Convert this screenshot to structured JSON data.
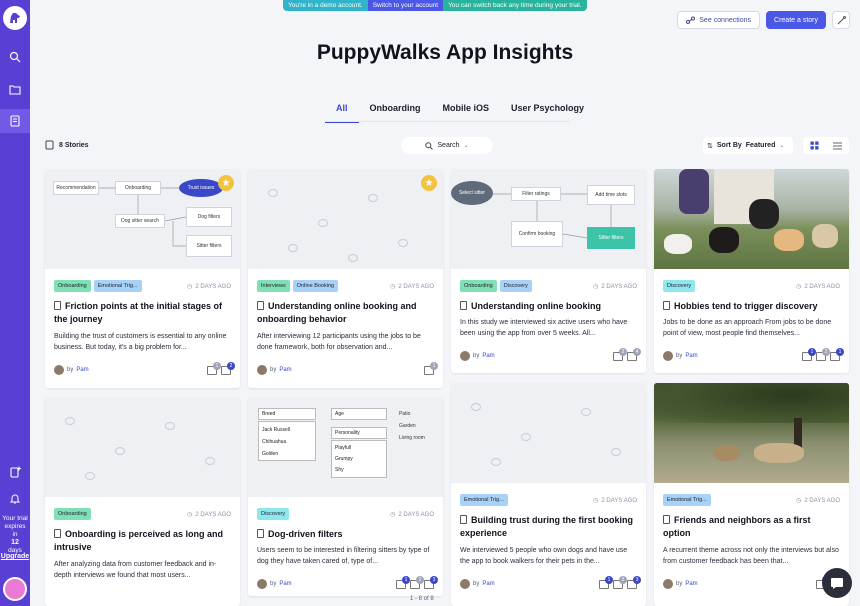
{
  "banner": {
    "demo": "You're in a demo account.",
    "switch": "Switch to your account",
    "info": "You can switch back any time during your trial.",
    "colors": {
      "demo": "#2fb4c9",
      "switch": "#4b57e5",
      "info": "#28b49c"
    }
  },
  "header": {
    "see_connections": "See connections",
    "create_story": "Create a story",
    "title": "PuppyWalks App Insights"
  },
  "tabs": [
    {
      "label": "All",
      "active": true
    },
    {
      "label": "Onboarding",
      "active": false
    },
    {
      "label": "Mobile iOS",
      "active": false
    },
    {
      "label": "User Psychology",
      "active": false
    }
  ],
  "toolbar": {
    "stories_count": "8 Stories",
    "search_label": "Search",
    "sort_label": "Sort By",
    "sort_value": "Featured"
  },
  "sidebar": {
    "trial_line1": "Your trial",
    "trial_line2": "expires",
    "trial_line3": "in",
    "trial_days": "12",
    "trial_line4": "days",
    "upgrade": "Upgrade"
  },
  "cards": [
    {
      "tags": [
        {
          "label": "Onboarding",
          "color": "green"
        },
        {
          "label": "Emotional Trig...",
          "color": "blue"
        }
      ],
      "date": "2 DAYS AGO",
      "title": "Friction points at the initial stages of the journey",
      "desc": "Building the trust of customers is essential to any online business. But today, it's a big problem for...",
      "author_prefix": "by",
      "author": "Pam",
      "badges": [
        "1",
        "2"
      ],
      "starred": true,
      "diagram": [
        "Recommendation",
        "Onboarding",
        "Trust issues",
        "Dog sitter search",
        "Dog filters",
        "Sitter filters"
      ]
    },
    {
      "tags": [
        {
          "label": "Interviews",
          "color": "green"
        },
        {
          "label": "Online Booking",
          "color": "blue"
        }
      ],
      "date": "2 DAYS AGO",
      "title": "Understanding online booking and onboarding behavior",
      "desc": "After interviewing 12 participants using the jobs to be done framework, both for observation and...",
      "author_prefix": "by",
      "author": "Pam",
      "badges": [
        "1"
      ],
      "starred": true
    },
    {
      "tags": [
        {
          "label": "Onboarding",
          "color": "green"
        },
        {
          "label": "Discovery",
          "color": "blue"
        }
      ],
      "date": "2 DAYS AGO",
      "title": "Understanding online booking",
      "desc": "In this study we interviewed six active users who have been using the app from over 5 weeks. All...",
      "author_prefix": "by",
      "author": "Pam",
      "badges": [
        "2",
        "4"
      ],
      "diagram": [
        "Select sitter",
        "Filter ratings",
        "Add time slots",
        "Confirm booking",
        "Sitter filters"
      ]
    },
    {
      "tags": [
        {
          "label": "Discovery",
          "color": "teal"
        }
      ],
      "date": "2 DAYS AGO",
      "title": "Hobbies tend to trigger discovery",
      "desc": "Jobs to be done as an approach From jobs to be done point of view, most people find themselves...",
      "author_prefix": "by",
      "author": "Pam",
      "badges": [
        "1",
        "2",
        "1"
      ]
    },
    {
      "tags": [
        {
          "label": "Onboarding",
          "color": "green"
        }
      ],
      "date": "2 DAYS AGO",
      "title": "Onboarding is perceived as long and intrusive",
      "desc": "After analyzing data from customer feedback and in-depth interviews we found that most users...",
      "author_prefix": "by",
      "author": "Pam",
      "badges": []
    },
    {
      "tags": [
        {
          "label": "Discovery",
          "color": "teal"
        }
      ],
      "date": "2 DAYS AGO",
      "title": "Dog-driven filters",
      "desc": "Users seem to be interested in filtering sitters by type of dog they have taken cared of, type of...",
      "author_prefix": "by",
      "author": "Pam",
      "badges": [
        "1",
        "2",
        "3"
      ],
      "form": {
        "breed": "Breed",
        "breeds": [
          "Jack Russell",
          "Chihuahua",
          "Golden"
        ],
        "age": "Age",
        "personality": "Personality",
        "personalities": [
          "Playfull",
          "Grumpy",
          "Shy"
        ],
        "places": [
          "Patio",
          "Garden",
          "Living room"
        ]
      }
    },
    {
      "tags": [
        {
          "label": "Emotional Trig...",
          "color": "blue"
        }
      ],
      "date": "2 DAYS AGO",
      "title": "Building trust during the first booking experience",
      "desc": "We interviewed 5 people who own dogs and have use the app to book walkers for their pets in the...",
      "author_prefix": "by",
      "author": "Pam",
      "badges": [
        "1",
        "2",
        "3"
      ]
    },
    {
      "tags": [
        {
          "label": "Emotional Trig...",
          "color": "blue"
        }
      ],
      "date": "2 DAYS AGO",
      "title": "Friends and neighbors as a first option",
      "desc": "A recurrent theme across not only the interviews but also from customer feedback has been that...",
      "author_prefix": "by",
      "author": "Pam",
      "badges": [
        "1",
        "2"
      ]
    }
  ],
  "pager": "1 - 8 of 8"
}
